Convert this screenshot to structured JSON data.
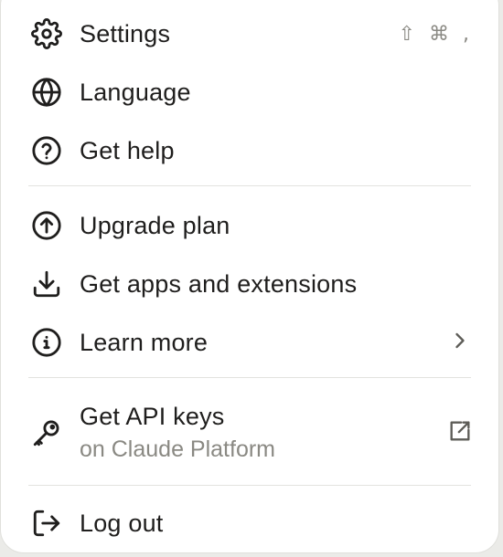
{
  "menu": {
    "items": [
      {
        "label": "Settings",
        "icon": "gear-icon",
        "shortcut": "⇧ ⌘ ,"
      },
      {
        "label": "Language",
        "icon": "globe-icon"
      },
      {
        "label": "Get help",
        "icon": "question-circle-icon"
      },
      {
        "label": "Upgrade plan",
        "icon": "arrow-up-circle-icon"
      },
      {
        "label": "Get apps and extensions",
        "icon": "download-icon"
      },
      {
        "label": "Learn more",
        "icon": "info-circle-icon",
        "trailing_icon": "chevron-right-icon"
      },
      {
        "label": "Get API keys",
        "sublabel": "on Claude Platform",
        "icon": "key-icon",
        "trailing_icon": "external-link-icon"
      },
      {
        "label": "Log out",
        "icon": "logout-icon"
      }
    ]
  },
  "colors": {
    "text": "#1f1e1d",
    "muted": "#8a8983",
    "divider": "#e3e3df",
    "background": "#ffffff"
  }
}
